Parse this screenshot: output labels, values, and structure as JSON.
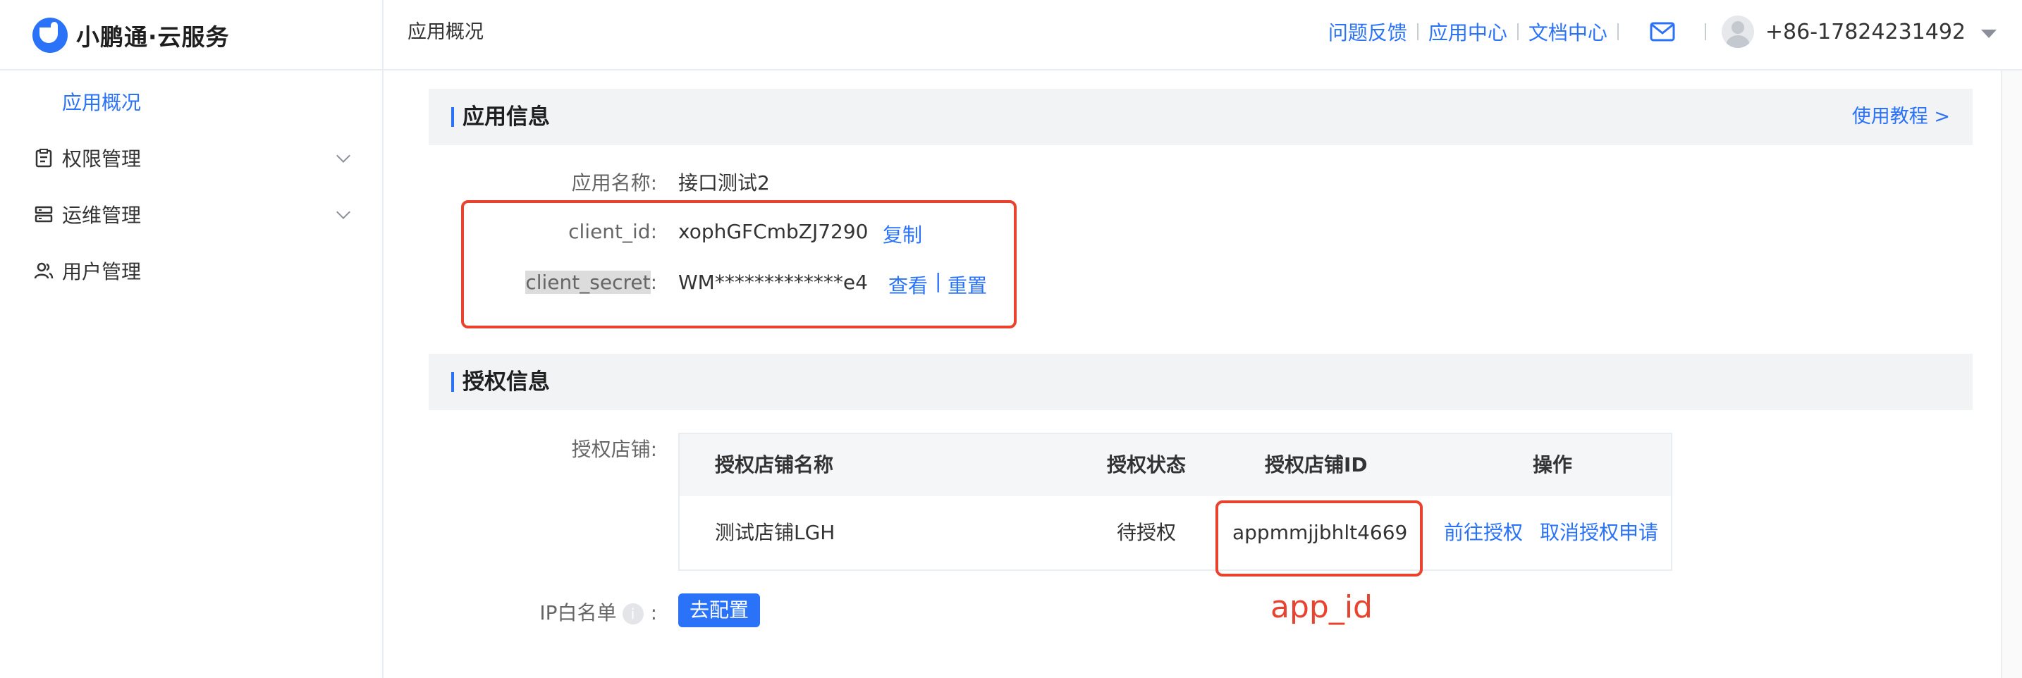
{
  "header": {
    "logo_text": "小鹏通·云服务",
    "page_title": "应用概况",
    "links": [
      "问题反馈",
      "应用中心",
      "文档中心"
    ],
    "user_phone": "+86-17824231492"
  },
  "sidebar": {
    "active_sub": "应用概况",
    "items": [
      {
        "label": "权限管理",
        "icon": "clipboard-icon"
      },
      {
        "label": "运维管理",
        "icon": "server-icon"
      },
      {
        "label": "用户管理",
        "icon": "users-icon"
      }
    ]
  },
  "app_info": {
    "title": "应用信息",
    "tutorial": "使用教程 >",
    "name_label": "应用名称:",
    "name_value": "接口测试2",
    "client_id_label": "client_id:",
    "client_id_value": "xophGFCmbZJ7290",
    "copy": "复制",
    "client_secret_label": "client_secret",
    "client_secret_colon": ":",
    "client_secret_value": "WM*************e4",
    "view": "查看",
    "link_sep": "|",
    "reset": "重置"
  },
  "auth_info": {
    "title": "授权信息",
    "stores_label": "授权店铺:",
    "table": {
      "headers": [
        "授权店铺名称",
        "授权状态",
        "授权店铺ID",
        "操作"
      ],
      "rows": [
        {
          "name": "测试店铺LGH",
          "status": "待授权",
          "store_id": "appmmjjbhlt4669",
          "actions": [
            "前往授权",
            "取消授权申请"
          ]
        }
      ]
    },
    "ip_label": "IP白名单",
    "ip_info_icon": "i",
    "ip_colon": ":",
    "config_button": "去配置",
    "annotation": "app_id"
  },
  "colors": {
    "accent": "#2a72f8",
    "annotation_red": "#e8432e"
  }
}
